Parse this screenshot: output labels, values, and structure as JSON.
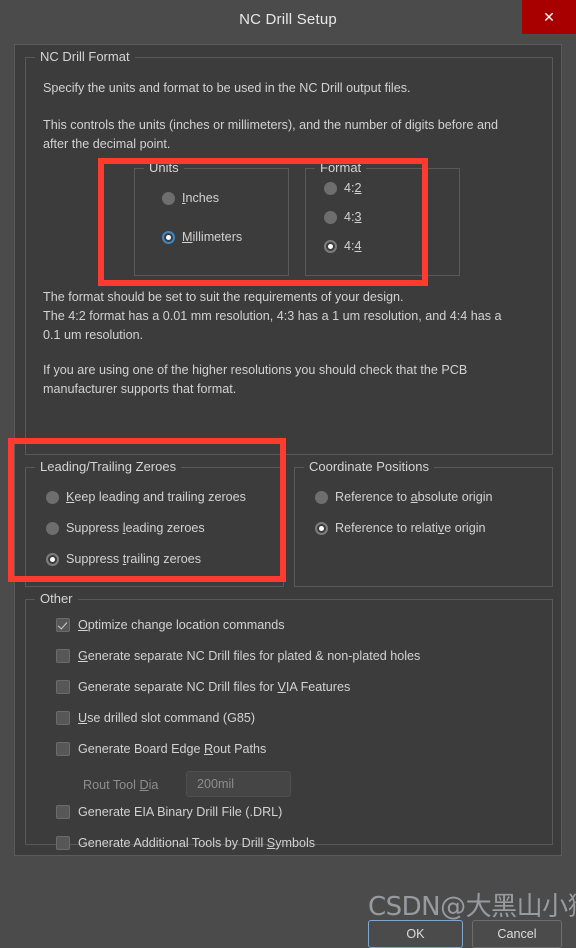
{
  "window": {
    "title": "NC Drill Setup",
    "close_label": "✕"
  },
  "nc_drill_format": {
    "legend": "NC Drill Format",
    "paragraph_1": "Specify the units and format to be used in the NC Drill output files.",
    "paragraph_2": "This controls the units (inches or millimeters), and the number of digits before and\nafter the decimal point.",
    "paragraph_3": "The format should be set to suit the requirements of your design.\nThe 4:2 format has a 0.01 mm resolution, 4:3 has a 1 um resolution, and 4:4 has a\n0.1 um resolution.",
    "paragraph_4": "If you are using one of the higher resolutions you should check that the PCB\nmanufacturer supports that format.",
    "units": {
      "legend": "Units",
      "options": [
        {
          "label": "Inches",
          "mnemonic": "I",
          "checked": false
        },
        {
          "label": "Millimeters",
          "mnemonic": "M",
          "checked": true
        }
      ]
    },
    "format": {
      "legend": "Format",
      "options": [
        {
          "label": "4:2",
          "mnemonic": "2",
          "checked": false
        },
        {
          "label": "4:3",
          "mnemonic": "3",
          "checked": false
        },
        {
          "label": "4:4",
          "mnemonic": "4",
          "checked": true
        }
      ]
    }
  },
  "leading_trailing_zeroes": {
    "legend": "Leading/Trailing Zeroes",
    "options": [
      {
        "label": "Keep leading and trailing zeroes",
        "checked": false
      },
      {
        "label": "Suppress leading zeroes",
        "checked": false
      },
      {
        "label": "Suppress trailing zeroes",
        "checked": true
      }
    ]
  },
  "coordinate_positions": {
    "legend": "Coordinate Positions",
    "options": [
      {
        "label": "Reference to absolute origin",
        "checked": false
      },
      {
        "label": "Reference to relative origin",
        "checked": true
      }
    ]
  },
  "other": {
    "legend": "Other",
    "checkboxes": [
      {
        "label": "Optimize change location commands",
        "checked": true
      },
      {
        "label": "Generate separate NC Drill files for plated & non-plated holes",
        "checked": false
      },
      {
        "label": "Generate separate NC Drill files for VIA Features",
        "checked": false
      },
      {
        "label": "Use drilled slot command (G85)",
        "checked": false
      },
      {
        "label": "Generate Board Edge Rout Paths",
        "checked": false
      },
      {
        "label": "Generate EIA Binary Drill File (.DRL)",
        "checked": false
      },
      {
        "label": "Generate Additional Tools by Drill Symbols",
        "checked": false
      }
    ],
    "rout_tool_dia": {
      "label": "Rout Tool Dia",
      "value": "200mil"
    }
  },
  "footer": {
    "ok_label": "OK",
    "cancel_label": "Cancel"
  },
  "watermark": {
    "text": "CSDN@大黑山小猴子"
  },
  "colors": {
    "accent_red": "#ff3b30",
    "close_red": "#a80000",
    "focus_blue": "#3d88c4",
    "panel_bg": "#3c3c3c",
    "dialog_bg": "#4b4b4b"
  }
}
